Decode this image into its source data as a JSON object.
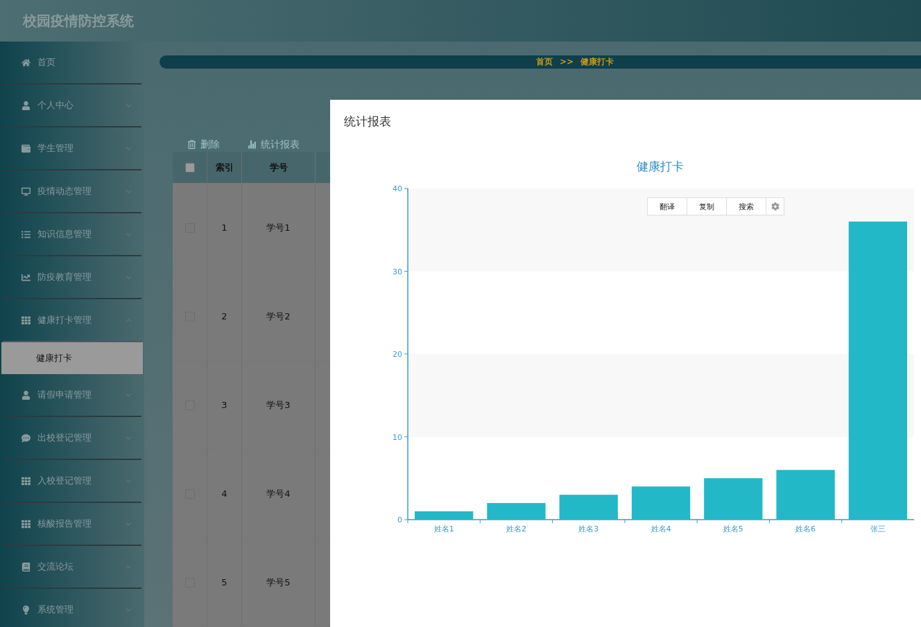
{
  "header": {
    "title": "校园疫情防控系统"
  },
  "sidebar": {
    "items": [
      {
        "label": "首页",
        "kind": "link",
        "expanded": false
      },
      {
        "label": "个人中心",
        "kind": "menu",
        "expanded": false
      },
      {
        "label": "学生管理",
        "kind": "menu",
        "expanded": false
      },
      {
        "label": "疫情动态管理",
        "kind": "menu",
        "expanded": false
      },
      {
        "label": "知识信息管理",
        "kind": "menu",
        "expanded": false
      },
      {
        "label": "防疫教育管理",
        "kind": "menu",
        "expanded": false
      },
      {
        "label": "健康打卡管理",
        "kind": "menu",
        "expanded": true,
        "children": [
          {
            "label": "健康打卡",
            "selected": true
          }
        ]
      },
      {
        "label": "请假申请管理",
        "kind": "menu",
        "expanded": false
      },
      {
        "label": "出校登记管理",
        "kind": "menu",
        "expanded": false
      },
      {
        "label": "入校登记管理",
        "kind": "menu",
        "expanded": false
      },
      {
        "label": "核酸报告管理",
        "kind": "menu",
        "expanded": false
      },
      {
        "label": "交流论坛",
        "kind": "menu",
        "expanded": false
      },
      {
        "label": "系统管理",
        "kind": "menu",
        "expanded": false
      }
    ]
  },
  "breadcrumb": [
    "首页",
    ">>",
    "健康打卡"
  ],
  "toolbar": [
    "删除",
    "统计报表"
  ],
  "table": {
    "header_checked": false,
    "columns": [
      "索引",
      "学号"
    ],
    "rows": [
      {
        "checked": false,
        "cells": [
          "1",
          "学号1"
        ]
      },
      {
        "checked": false,
        "cells": [
          "2",
          "学号2"
        ]
      },
      {
        "checked": false,
        "cells": [
          "3",
          "学号3"
        ]
      },
      {
        "checked": false,
        "cells": [
          "4",
          "学号4"
        ]
      },
      {
        "checked": false,
        "cells": [
          "5",
          "学号5"
        ]
      }
    ]
  },
  "dialog": {
    "title": "统计报表",
    "chart_data": {
      "type": "bar",
      "title": "健康打卡",
      "categories": [
        "姓名1",
        "姓名2",
        "姓名3",
        "姓名4",
        "姓名5",
        "姓名6",
        "张三"
      ],
      "series": [
        {
          "color": "#22b8c8",
          "values": [
            1,
            2,
            3,
            4,
            5,
            6,
            36
          ]
        }
      ],
      "ylim": [
        0,
        40
      ],
      "yticks": [
        0,
        10,
        20,
        30,
        40
      ]
    },
    "selection_popup": [
      "翻译",
      "复制",
      "搜索"
    ]
  }
}
